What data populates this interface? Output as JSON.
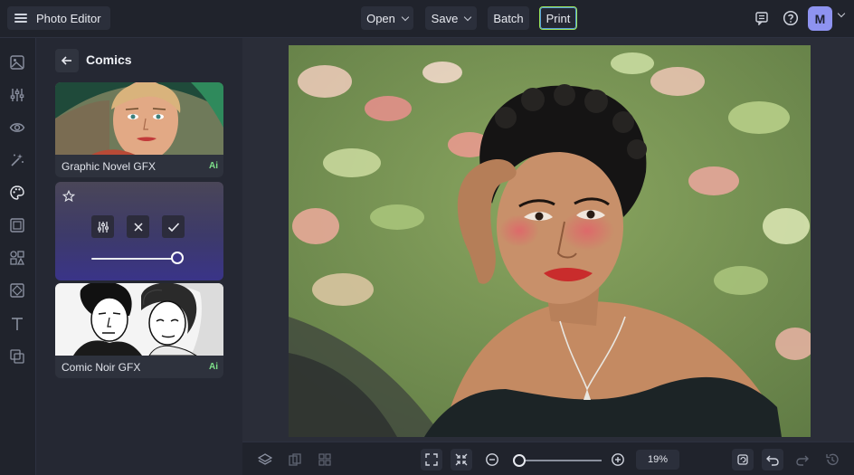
{
  "header": {
    "app_title": "Photo Editor",
    "open_label": "Open",
    "save_label": "Save",
    "batch_label": "Batch",
    "print_label": "Print",
    "avatar_initial": "M"
  },
  "panel": {
    "title": "Comics",
    "effects": [
      {
        "label": "Graphic Novel GFX",
        "badge": "Ai"
      },
      {
        "label": "Comic Noir GFX",
        "badge": "Ai"
      }
    ]
  },
  "active_effect": {
    "intensity_fraction": 0.95
  },
  "bottombar": {
    "zoom_label": "19%",
    "zoom_fraction": 0.05
  },
  "colors": {
    "accent_print_border": "#9be45a",
    "ai_badge": "#7ee08a",
    "avatar": "#8e93f0"
  }
}
